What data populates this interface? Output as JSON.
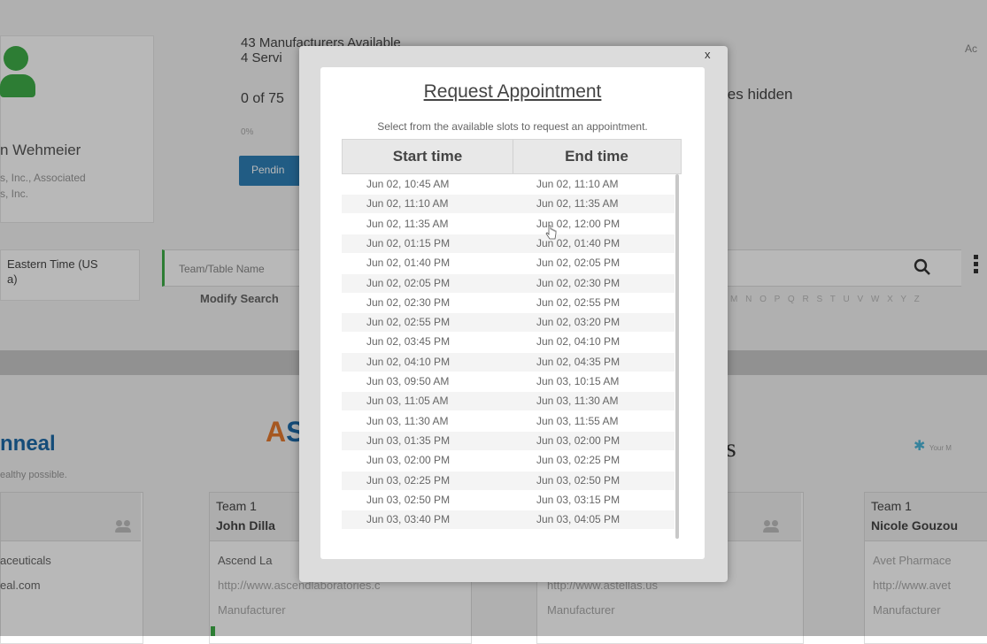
{
  "profile": {
    "name": "n Wehmeier",
    "company": "s, Inc., Associated\ns, Inc."
  },
  "stats": {
    "manufacturers": "43 Manufacturers Available",
    "services": "4 Servi",
    "progress_text": "0 of 75",
    "hidden_text": "les hidden",
    "percent": "0%",
    "pending_label": "Pendin"
  },
  "top_right": "Ac",
  "timezone": "Eastern Time (US\na)",
  "search": {
    "placeholder": "Team/Table Name",
    "modify_label": "Modify Search",
    "alphabet": "M N O P Q R S T U V W X Y Z"
  },
  "logos": {
    "l1": "nneal",
    "l1_sub": "ealthy possible.",
    "l2a": "A",
    "l2b": "S",
    "l3": "s",
    "l4": "Your M"
  },
  "teams": [
    {
      "team": "",
      "name": "",
      "company": "aceuticals",
      "url": "eal.com",
      "type": ""
    },
    {
      "team": "Team 1",
      "name": "John Dilla",
      "company": "Ascend La",
      "url": "http://www.ascendlaboratories.c",
      "type": "Manufacturer"
    },
    {
      "team": "",
      "name": "",
      "company": "",
      "url": "http://www.astellas.us",
      "type": "Manufacturer"
    },
    {
      "team": "Team 1",
      "name": "Nicole Gouzou",
      "company": "Avet Pharmace",
      "url": "http://www.avet",
      "type": "Manufacturer"
    }
  ],
  "modal": {
    "close_label": "x",
    "title": "Request Appointment",
    "subtitle": "Select from the available slots to request an appointment.",
    "col_start": "Start time",
    "col_end": "End time",
    "slots": [
      {
        "start": "Jun 02, 10:45 AM",
        "end": "Jun 02, 11:10 AM"
      },
      {
        "start": "Jun 02, 11:10 AM",
        "end": "Jun 02, 11:35 AM"
      },
      {
        "start": "Jun 02, 11:35 AM",
        "end": "Jun 02, 12:00 PM"
      },
      {
        "start": "Jun 02, 01:15 PM",
        "end": "Jun 02, 01:40 PM"
      },
      {
        "start": "Jun 02, 01:40 PM",
        "end": "Jun 02, 02:05 PM"
      },
      {
        "start": "Jun 02, 02:05 PM",
        "end": "Jun 02, 02:30 PM"
      },
      {
        "start": "Jun 02, 02:30 PM",
        "end": "Jun 02, 02:55 PM"
      },
      {
        "start": "Jun 02, 02:55 PM",
        "end": "Jun 02, 03:20 PM"
      },
      {
        "start": "Jun 02, 03:45 PM",
        "end": "Jun 02, 04:10 PM"
      },
      {
        "start": "Jun 02, 04:10 PM",
        "end": "Jun 02, 04:35 PM"
      },
      {
        "start": "Jun 03, 09:50 AM",
        "end": "Jun 03, 10:15 AM"
      },
      {
        "start": "Jun 03, 11:05 AM",
        "end": "Jun 03, 11:30 AM"
      },
      {
        "start": "Jun 03, 11:30 AM",
        "end": "Jun 03, 11:55 AM"
      },
      {
        "start": "Jun 03, 01:35 PM",
        "end": "Jun 03, 02:00 PM"
      },
      {
        "start": "Jun 03, 02:00 PM",
        "end": "Jun 03, 02:25 PM"
      },
      {
        "start": "Jun 03, 02:25 PM",
        "end": "Jun 03, 02:50 PM"
      },
      {
        "start": "Jun 03, 02:50 PM",
        "end": "Jun 03, 03:15 PM"
      },
      {
        "start": "Jun 03, 03:40 PM",
        "end": "Jun 03, 04:05 PM"
      }
    ]
  }
}
